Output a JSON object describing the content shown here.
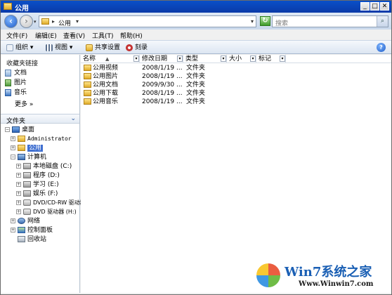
{
  "window": {
    "title": "公用",
    "controls": {
      "minimize": "_",
      "maximize": "□",
      "close": "✕"
    }
  },
  "address": {
    "back_icon": "back-arrow-icon",
    "forward_icon": "forward-arrow-icon",
    "separator": "▸",
    "path": "公用",
    "path_dropdown": "▾",
    "dropdown": "▾",
    "refresh_symbol": "↻",
    "search_placeholder": "搜索",
    "search_symbol": "⌕"
  },
  "menu": {
    "file": "文件(F)",
    "edit": "编辑(E)",
    "view": "查看(V)",
    "tools": "工具(T)",
    "help": "帮助(H)"
  },
  "toolbar": {
    "organize": "组织 ▾",
    "views": "视图 ▾",
    "share": "共享设置",
    "burn": "刻录",
    "help_symbol": "?"
  },
  "favorites": {
    "header": "收藏夹链接",
    "items": [
      "文档",
      "图片",
      "音乐"
    ],
    "more": "更多  »"
  },
  "folders": {
    "header": "文件夹",
    "chevron": "⌄"
  },
  "tree": [
    {
      "label": "桌面",
      "expander": "−"
    },
    {
      "label": "Administrator",
      "expander": "+"
    },
    {
      "label": "公用",
      "expander": "+"
    },
    {
      "label": "计算机",
      "expander": "−"
    },
    {
      "label": "本地磁盘 (C:)",
      "expander": "+"
    },
    {
      "label": "程序 (D:)",
      "expander": "+"
    },
    {
      "label": "学习 (E:)",
      "expander": "+"
    },
    {
      "label": "娱乐 (F:)",
      "expander": "+"
    },
    {
      "label": "DVD/CD-RW 驱动器",
      "expander": "+"
    },
    {
      "label": "DVD 驱动器 (H:)",
      "expander": "+"
    },
    {
      "label": "网络",
      "expander": "+"
    },
    {
      "label": "控制面板",
      "expander": "+"
    },
    {
      "label": "回收站",
      "expander": ""
    }
  ],
  "columns": {
    "name": "名称",
    "sort_indicator": "▲",
    "modified": "修改日期",
    "type": "类型",
    "size": "大小",
    "tags": "标记",
    "dropdown_symbol": "▾"
  },
  "files": [
    {
      "name": "公用视频",
      "date": "2008/1/19 ...",
      "type": "文件夹"
    },
    {
      "name": "公用图片",
      "date": "2008/1/19 ...",
      "type": "文件夹"
    },
    {
      "name": "公用文档",
      "date": "2009/9/30 ...",
      "type": "文件夹"
    },
    {
      "name": "公用下载",
      "date": "2008/1/19 ...",
      "type": "文件夹"
    },
    {
      "name": "公用音乐",
      "date": "2008/1/19 ...",
      "type": "文件夹"
    }
  ],
  "watermark": {
    "brand": "Win7系统之家",
    "url": "Www.Winwin7.com"
  }
}
